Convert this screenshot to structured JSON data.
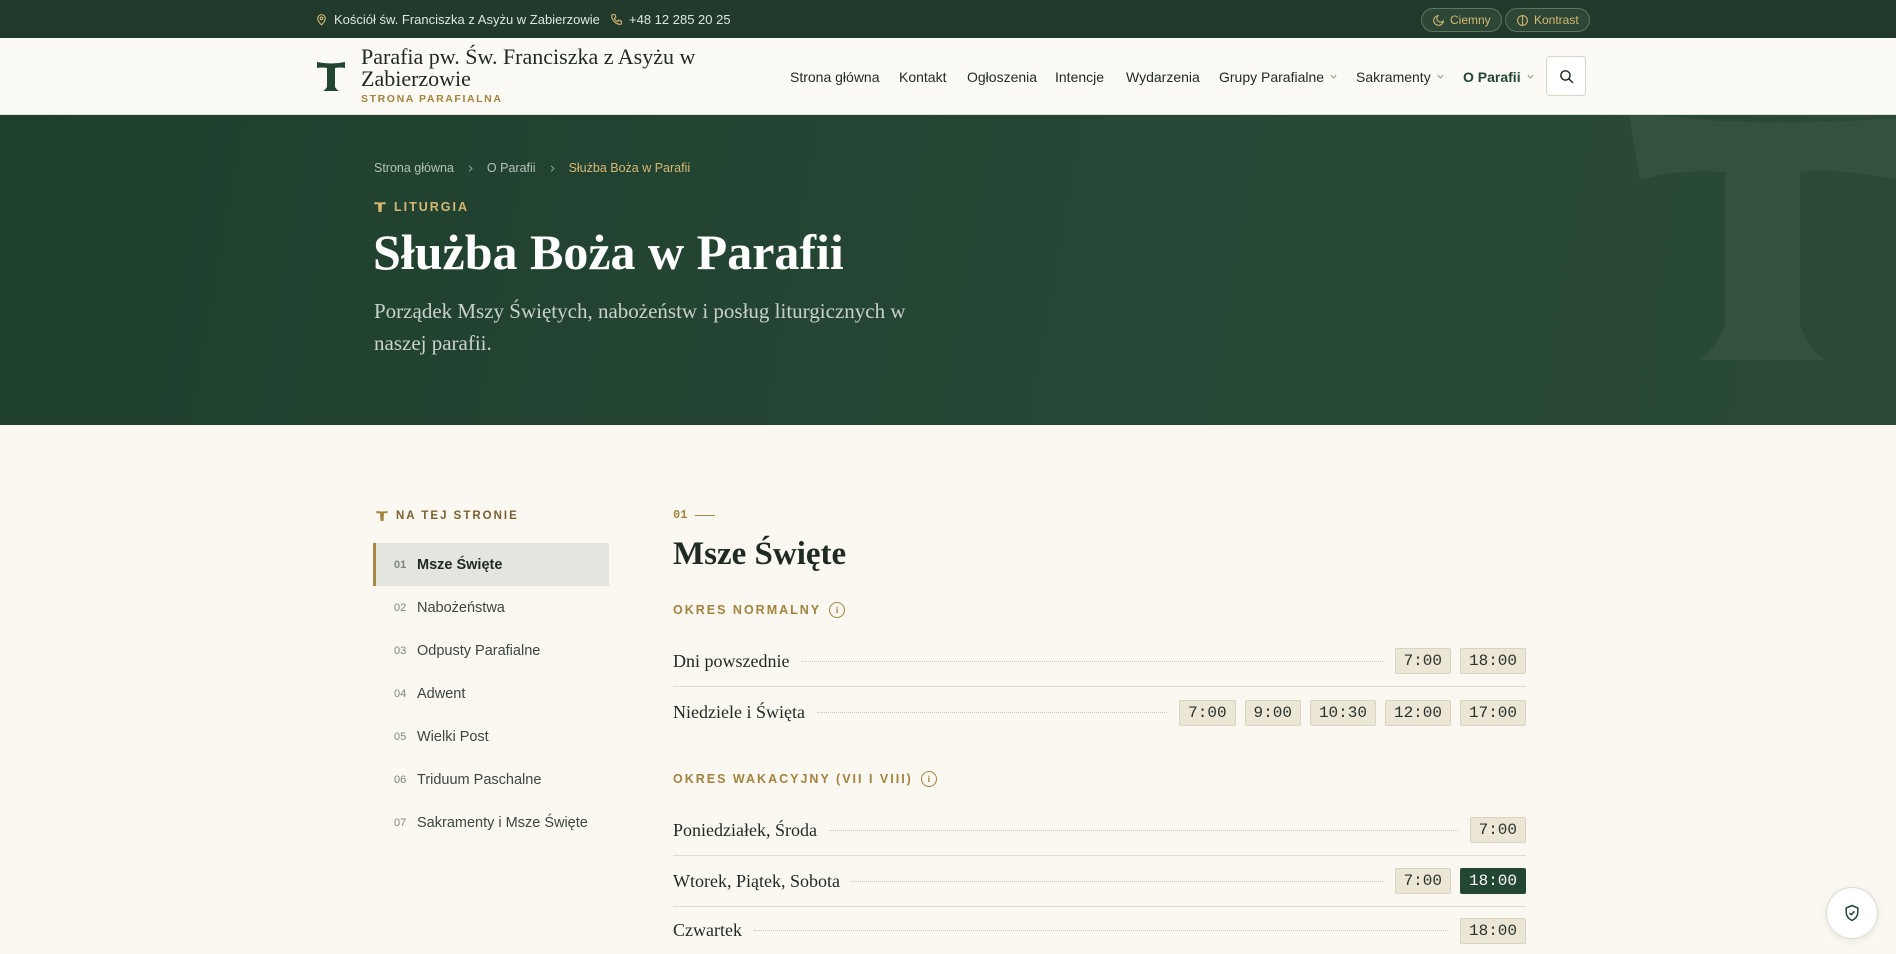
{
  "topbar": {
    "address": "Kościół św. Franciszka z Asyżu w Zabierzowie",
    "phone": "+48 12 285 20 25",
    "dark_label": "Ciemny",
    "contrast_label": "Kontrast"
  },
  "header": {
    "title": "Parafia pw. Św. Franciszka z Asyżu w Zabierzowie",
    "subtitle": "STRONA PARAFIALNA",
    "nav": {
      "home": "Strona główna",
      "contact": "Kontakt",
      "announcements": "Ogłoszenia",
      "intentions": "Intencje",
      "events": "Wydarzenia",
      "groups": "Grupy Parafialne",
      "sacraments": "Sakramenty",
      "about": "O Parafii"
    }
  },
  "hero": {
    "breadcrumbs": [
      "Strona główna",
      "O Parafii",
      "Służba Boża w Parafii"
    ],
    "eyebrow": "LITURGIA",
    "title": "Służba Boża w Parafii",
    "lead": "Porządek Mszy Świętych, nabożeństw i posług liturgicznych w naszej parafii."
  },
  "toc": {
    "heading": "NA TEJ STRONIE",
    "items": [
      {
        "num": "01",
        "label": "Msze Święte"
      },
      {
        "num": "02",
        "label": "Nabożeństwa"
      },
      {
        "num": "03",
        "label": "Odpusty Parafialne"
      },
      {
        "num": "04",
        "label": "Adwent"
      },
      {
        "num": "05",
        "label": "Wielki Post"
      },
      {
        "num": "06",
        "label": "Triduum Paschalne"
      },
      {
        "num": "07",
        "label": "Sakramenty i Msze Święte"
      }
    ]
  },
  "section": {
    "number": "01",
    "title": "Msze Święte",
    "periods": [
      {
        "label": "OKRES NORMALNY",
        "rows": [
          {
            "day": "Dni powszednie",
            "times": [
              "7:00",
              "18:00"
            ]
          },
          {
            "day": "Niedziele i Święta",
            "times": [
              "7:00",
              "9:00",
              "10:30",
              "12:00",
              "17:00"
            ]
          }
        ]
      },
      {
        "label": "OKRES WAKACYJNY (VII I VIII)",
        "rows": [
          {
            "day": "Poniedziałek, Środa",
            "times": [
              "7:00"
            ]
          },
          {
            "day": "Wtorek, Piątek, Sobota",
            "times": [
              "7:00",
              "18:00"
            ]
          },
          {
            "day": "Czwartek",
            "times": [
              "18:00"
            ]
          }
        ]
      }
    ]
  },
  "colors": {
    "primary_green": "#213a2b",
    "accent_gold": "#a2833f",
    "background": "#faf8f1"
  }
}
